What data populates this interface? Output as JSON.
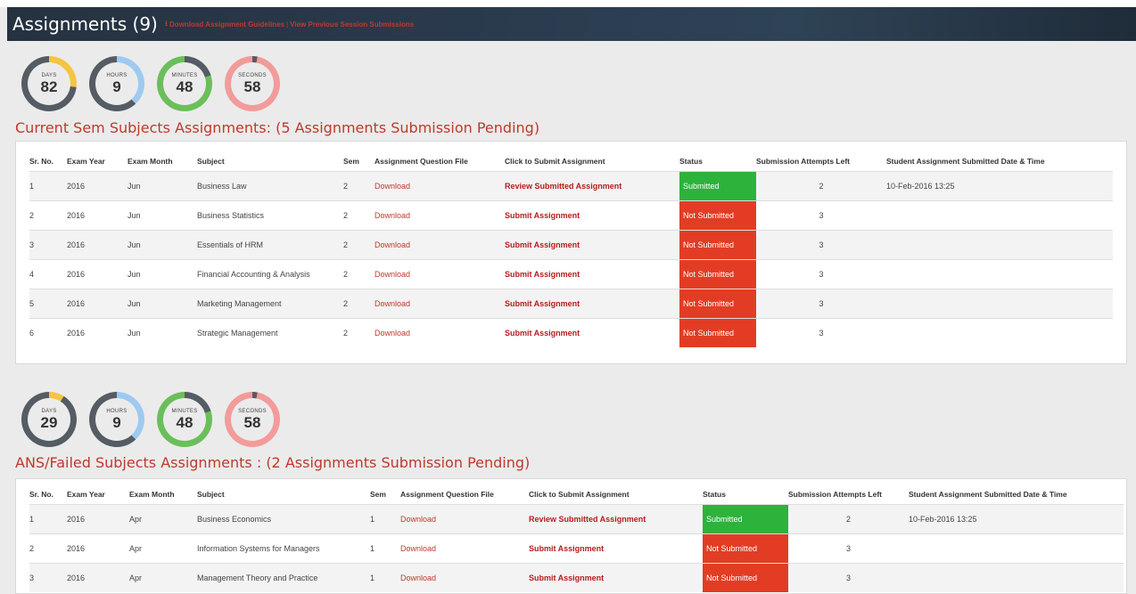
{
  "header": {
    "title": "Assignments (9)",
    "download_guidelines": "Download Assignment Guidelines",
    "separator": "|",
    "view_previous": "View Previous Session Submissions"
  },
  "timer1": [
    {
      "label": "DAYS",
      "value": "82",
      "color": "#f5c442"
    },
    {
      "label": "HOURS",
      "value": "9",
      "color": "#9fcaf0"
    },
    {
      "label": "MINUTES",
      "value": "48",
      "color": "#6bbf5a"
    },
    {
      "label": "SECONDS",
      "value": "58",
      "color": "#f29b9b"
    }
  ],
  "timer2": [
    {
      "label": "DAYS",
      "value": "29",
      "color": "#f5c442"
    },
    {
      "label": "HOURS",
      "value": "9",
      "color": "#9fcaf0"
    },
    {
      "label": "MINUTES",
      "value": "48",
      "color": "#6bbf5a"
    },
    {
      "label": "SECONDS",
      "value": "58",
      "color": "#f29b9b"
    }
  ],
  "columns": [
    "Sr. No.",
    "Exam Year",
    "Exam Month",
    "Subject",
    "Sem",
    "Assignment Question File",
    "Click to Submit Assignment",
    "Status",
    "Submission Attempts Left",
    "Student Assignment Submitted Date & Time"
  ],
  "current": {
    "title": "Current Sem Subjects Assignments: (5 Assignments Submission Pending)",
    "rows": [
      {
        "sr": "1",
        "year": "2016",
        "month": "Jun",
        "subject": "Business Law",
        "sem": "2",
        "file": "Download",
        "action": "Review Submitted Assignment",
        "status": "Submitted",
        "attempts": "2",
        "date": "10-Feb-2016 13:25"
      },
      {
        "sr": "2",
        "year": "2016",
        "month": "Jun",
        "subject": "Business Statistics",
        "sem": "2",
        "file": "Download",
        "action": "Submit Assignment",
        "status": "Not Submitted",
        "attempts": "3",
        "date": ""
      },
      {
        "sr": "3",
        "year": "2016",
        "month": "Jun",
        "subject": "Essentials of HRM",
        "sem": "2",
        "file": "Download",
        "action": "Submit Assignment",
        "status": "Not Submitted",
        "attempts": "3",
        "date": ""
      },
      {
        "sr": "4",
        "year": "2016",
        "month": "Jun",
        "subject": "Financial Accounting & Analysis",
        "sem": "2",
        "file": "Download",
        "action": "Submit Assignment",
        "status": "Not Submitted",
        "attempts": "3",
        "date": ""
      },
      {
        "sr": "5",
        "year": "2016",
        "month": "Jun",
        "subject": "Marketing Management",
        "sem": "2",
        "file": "Download",
        "action": "Submit Assignment",
        "status": "Not Submitted",
        "attempts": "3",
        "date": ""
      },
      {
        "sr": "6",
        "year": "2016",
        "month": "Jun",
        "subject": "Strategic Management",
        "sem": "2",
        "file": "Download",
        "action": "Submit Assignment",
        "status": "Not Submitted",
        "attempts": "3",
        "date": ""
      }
    ]
  },
  "failed": {
    "title": "ANS/Failed Subjects Assignments : (2 Assignments Submission Pending)",
    "rows": [
      {
        "sr": "1",
        "year": "2016",
        "month": "Apr",
        "subject": "Business Economics",
        "sem": "1",
        "file": "Download",
        "action": "Review Submitted Assignment",
        "status": "Submitted",
        "attempts": "2",
        "date": "10-Feb-2016 13:25"
      },
      {
        "sr": "2",
        "year": "2016",
        "month": "Apr",
        "subject": "Information Systems for Managers",
        "sem": "1",
        "file": "Download",
        "action": "Submit Assignment",
        "status": "Not Submitted",
        "attempts": "3",
        "date": ""
      },
      {
        "sr": "3",
        "year": "2016",
        "month": "Apr",
        "subject": "Management Theory and Practice",
        "sem": "1",
        "file": "Download",
        "action": "Submit Assignment",
        "status": "Not Submitted",
        "attempts": "3",
        "date": ""
      }
    ]
  }
}
